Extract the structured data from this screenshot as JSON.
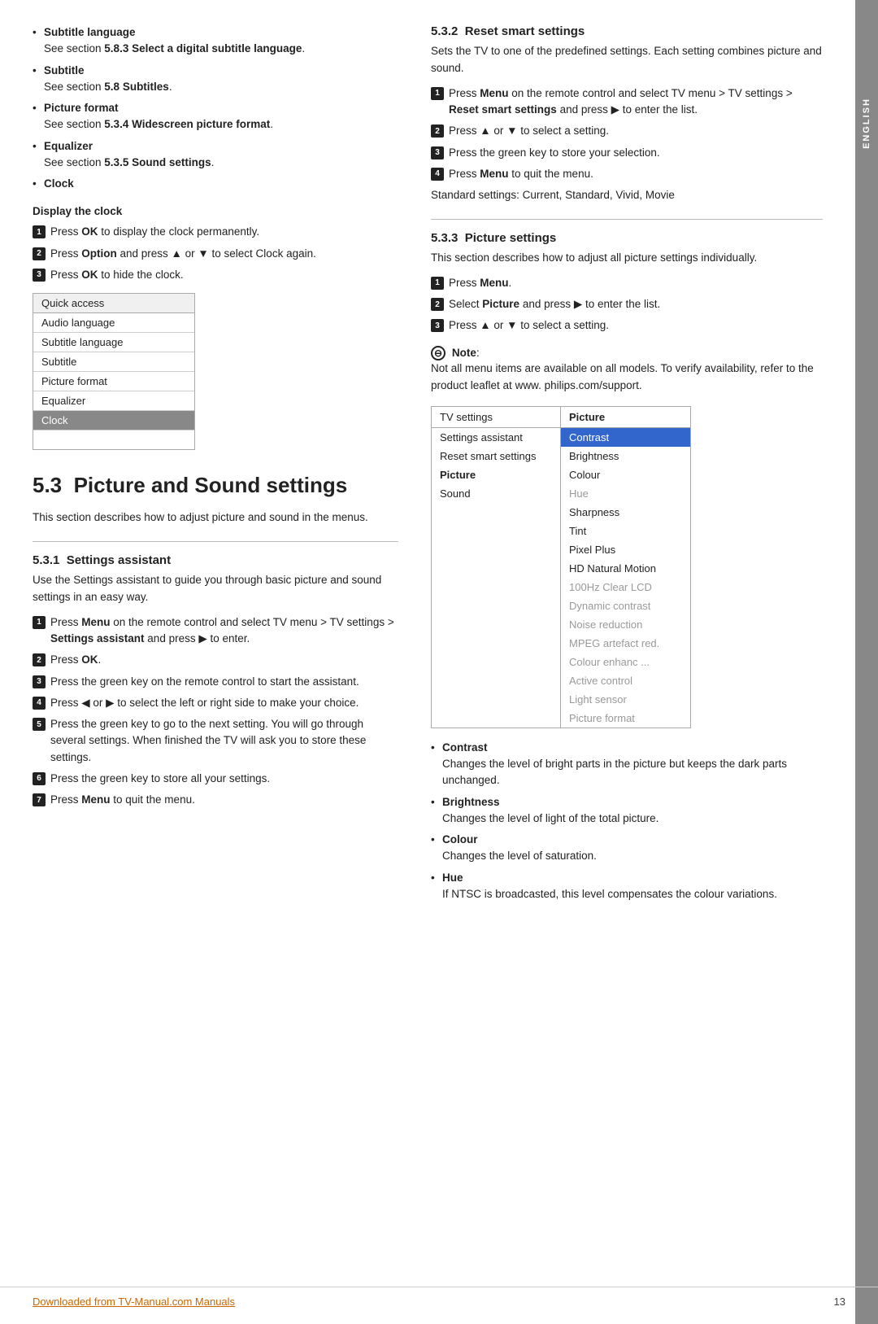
{
  "sidebar": {
    "label": "ENGLISH"
  },
  "left_col": {
    "bullet_items": [
      {
        "label": "Subtitle language",
        "detail": "See section ",
        "detail_bold": "5.8.3 Select a digital subtitle language",
        "detail_end": "."
      },
      {
        "label": "Subtitle",
        "detail": "See section ",
        "detail_bold": "5.8 Subtitles",
        "detail_end": "."
      },
      {
        "label": "Picture format",
        "detail": "See section ",
        "detail_bold": "5.3.4 Widescreen picture format",
        "detail_end": "."
      },
      {
        "label": "Equalizer",
        "detail": "See section ",
        "detail_bold": "5.3.5 Sound settings",
        "detail_end": "."
      },
      {
        "label": "Clock",
        "detail": ""
      }
    ],
    "display_clock": {
      "title": "Display the clock",
      "steps": [
        "Press OK to display the clock permanently.",
        "Press Option and press ▲ or ▼ to select Clock again.",
        "Press OK to hide the clock."
      ]
    },
    "quick_access": {
      "header": "Quick access",
      "items": [
        "Audio language",
        "Subtitle language",
        "Subtitle",
        "Picture format",
        "Equalizer",
        "Clock"
      ],
      "selected": "Clock"
    },
    "big_section": {
      "number": "5.3",
      "title": "Picture and Sound settings"
    },
    "intro_text": "This section describes how to adjust picture and sound in the menus.",
    "section531": {
      "number": "5.3.1",
      "title": "Settings assistant",
      "intro": "Use the Settings assistant to guide you through basic picture and sound settings in an easy way.",
      "steps": [
        "Press Menu on the remote control and select TV menu > TV settings > Settings assistant and press ▶ to enter.",
        "Press OK.",
        "Press the green key on the remote control to start the assistant.",
        "Press ◀ or ▶ to select the left or right side to make your choice.",
        "Press the green key to go to the next setting. You will go through several settings. When finished the TV will ask you to store these settings.",
        "Press the green key to store all your settings.",
        "Press Menu to quit the menu."
      ]
    }
  },
  "right_col": {
    "section532": {
      "number": "5.3.2",
      "title": "Reset smart settings",
      "intro": "Sets the TV to one of the predefined settings. Each setting combines picture and sound.",
      "steps": [
        "Press Menu on the remote control and select TV menu > TV settings > Reset smart settings and press ▶ to enter the list.",
        "Press ▲ or ▼ to select a setting.",
        "Press the green key to store your selection.",
        "Press Menu to quit the menu."
      ],
      "note": "Standard settings: Current, Standard, Vivid, Movie"
    },
    "section533": {
      "number": "5.3.3",
      "title": "Picture settings",
      "intro": "This section describes how to adjust all picture settings individually.",
      "steps": [
        "Press Menu.",
        "Select Picture and press ▶ to enter the list.",
        "Press ▲ or ▼ to select a setting."
      ]
    },
    "note_block": {
      "label": "Note",
      "text": "Not all menu items are available on all models. To verify availability, refer to the product leaflet at www. philips.com/support."
    },
    "tv_settings_table": {
      "col1_header": "TV settings",
      "col2_header": "Picture",
      "rows": [
        {
          "left": "Settings assistant",
          "right": "Contrast",
          "right_highlight": true
        },
        {
          "left": "Reset smart settings",
          "right": "Brightness",
          "right_highlight": false
        },
        {
          "left": "Picture",
          "right": "Colour",
          "right_highlight": false,
          "left_selected": true
        },
        {
          "left": "Sound",
          "right": "Hue",
          "right_highlight": false,
          "right_gray": true
        },
        {
          "left": "",
          "right": "Sharpness"
        },
        {
          "left": "",
          "right": "Tint"
        },
        {
          "left": "",
          "right": "Pixel Plus"
        },
        {
          "left": "",
          "right": "HD Natural Motion"
        },
        {
          "left": "",
          "right": "100Hz Clear LCD"
        },
        {
          "left": "",
          "right": "Dynamic contrast"
        },
        {
          "left": "",
          "right": "Noise reduction"
        },
        {
          "left": "",
          "right": "MPEG artefact red."
        },
        {
          "left": "",
          "right": "Colour enhanc ..."
        },
        {
          "left": "",
          "right": "Active control"
        },
        {
          "left": "",
          "right": "Light sensor"
        },
        {
          "left": "",
          "right": "Picture format"
        }
      ]
    },
    "picture_items": [
      {
        "label": "Contrast",
        "detail": "Changes the level of bright parts in the picture but keeps the dark parts unchanged."
      },
      {
        "label": "Brightness",
        "detail": "Changes the level of light of the total picture."
      },
      {
        "label": "Colour",
        "detail": "Changes the level of saturation."
      },
      {
        "label": "Hue",
        "detail": "If NTSC is broadcasted, this level compensates the colour variations."
      }
    ]
  },
  "footer": {
    "link_text": "Downloaded from TV-Manual.com Manuals",
    "page_number": "13"
  }
}
